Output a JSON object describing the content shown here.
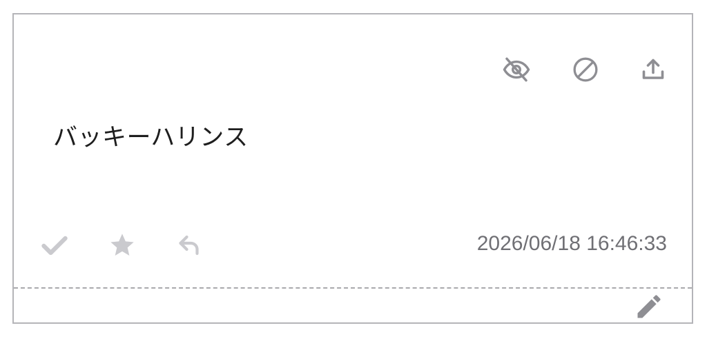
{
  "message": {
    "text": "バッキーハリンス",
    "timestamp": "2026/06/18 16:46:33"
  },
  "colors": {
    "border": "#b4b4b8",
    "icon_dark": "#8e8e93",
    "icon_light": "#cacace",
    "text": "#1e1e1e",
    "timestamp": "#6f6f74",
    "divider": "#a8a8ac"
  },
  "icons": {
    "top": [
      "eye-off-icon",
      "block-icon",
      "upload-icon"
    ],
    "bottom": [
      "check-icon",
      "star-icon",
      "reply-icon"
    ],
    "footer": [
      "pencil-icon"
    ]
  }
}
